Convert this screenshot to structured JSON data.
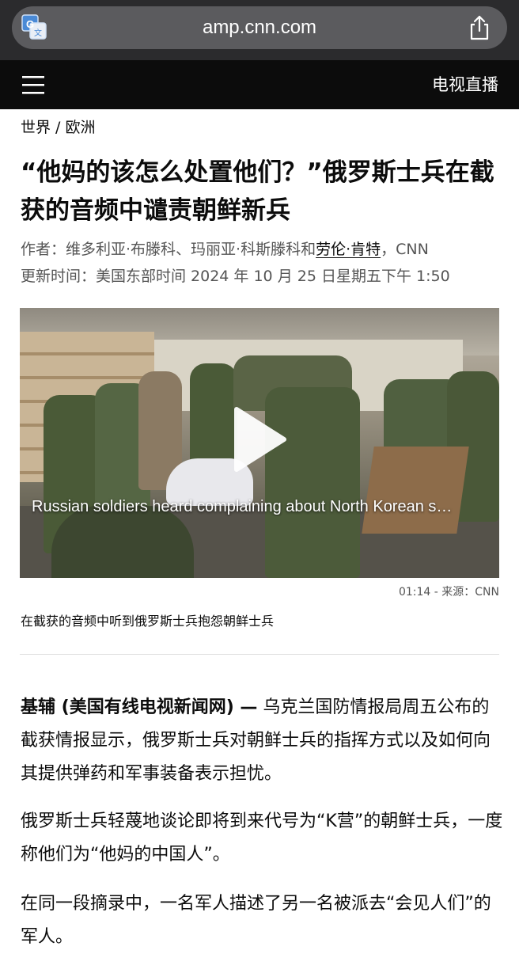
{
  "browser": {
    "url": "amp.cnn.com",
    "translate_icon": "translate-icon",
    "share_icon": "share-icon"
  },
  "site_header": {
    "menu_icon": "hamburger-menu-icon",
    "live_tv_label": "电视直播"
  },
  "article": {
    "breadcrumb": "世界 / 欧洲",
    "headline": "“他妈的该怎么处置他们？”俄罗斯士兵在截获的音频中谴责朝鲜新兵",
    "byline_prefix": "作者：维多利亚·布滕科、玛丽亚·科斯滕科和",
    "byline_author_link": "劳伦·肯特",
    "byline_suffix": "，CNN",
    "updated": "更新时间：美国东部时间 2024 年 10 月 25 日星期五下午 1:50",
    "video": {
      "title": "Russian soldiers heard complaining about North Korean s…",
      "meta": "01:14 - 来源：CNN",
      "caption": "在截获的音频中听到俄罗斯士兵抱怨朝鲜士兵",
      "play_icon": "play-icon"
    },
    "paragraphs": [
      {
        "dateline": "基辅 (美国有线电视新闻网) —",
        "text": " 乌克兰国防情报局周五公布的截获情报显示，俄罗斯士兵对朝鲜士兵的指挥方式以及如何向其提供弹药和军事装备表示担忧。"
      },
      {
        "text": "俄罗斯士兵轻蔑地谈论即将到来代号为“K营”的朝鲜士兵，一度称他们为“他妈的中国人”。"
      },
      {
        "text": "在同一段摘录中，一名军人描述了另一名被派去“会见人们”的军人。"
      }
    ]
  },
  "colors": {
    "chrome_bg": "#2b2b2d",
    "urlbar_bg": "#5b5b5e",
    "header_bg": "#0c0c0c",
    "text": "#0c0c0c",
    "meta_text": "#555555"
  }
}
